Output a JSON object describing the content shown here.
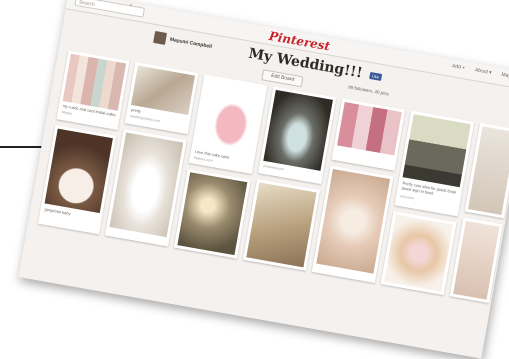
{
  "header": {
    "search_placeholder": "Search",
    "logo_text": "Pinterest",
    "nav": [
      "Add +",
      "About ▾",
      "Mayumi ▾"
    ]
  },
  "board": {
    "owner": "Mayumi Campbell",
    "title": "My Wedding!!!",
    "like_label": "Like",
    "edit_label": "Edit Board",
    "stats": "89 followers, 40 pins"
  },
  "pins": [
    {
      "caption": "my rustic and cool bridal collection",
      "source": "Maybe"
    },
    {
      "caption": "pretty",
      "source": "weddingchicks.com"
    },
    {
      "caption": "",
      "source": ""
    },
    {
      "caption": "Love this cake color",
      "source": "theknot.com"
    },
    {
      "caption": "",
      "source": "pinterest.com"
    },
    {
      "caption": "gorgeous baby",
      "source": ""
    },
    {
      "caption": "",
      "source": ""
    },
    {
      "caption": "",
      "source": ""
    },
    {
      "caption": "",
      "source": ""
    },
    {
      "caption": "",
      "source": ""
    },
    {
      "caption": "Pretty cute idea for guest book guest sign in book",
      "source": "etsy.com"
    },
    {
      "caption": "",
      "source": ""
    },
    {
      "caption": "",
      "source": ""
    },
    {
      "caption": "",
      "source": ""
    },
    {
      "caption": "",
      "source": ""
    }
  ],
  "colors": {
    "accent": "#c8232c",
    "page_bg": "#f4f1ee",
    "card_bg": "#ffffff"
  }
}
